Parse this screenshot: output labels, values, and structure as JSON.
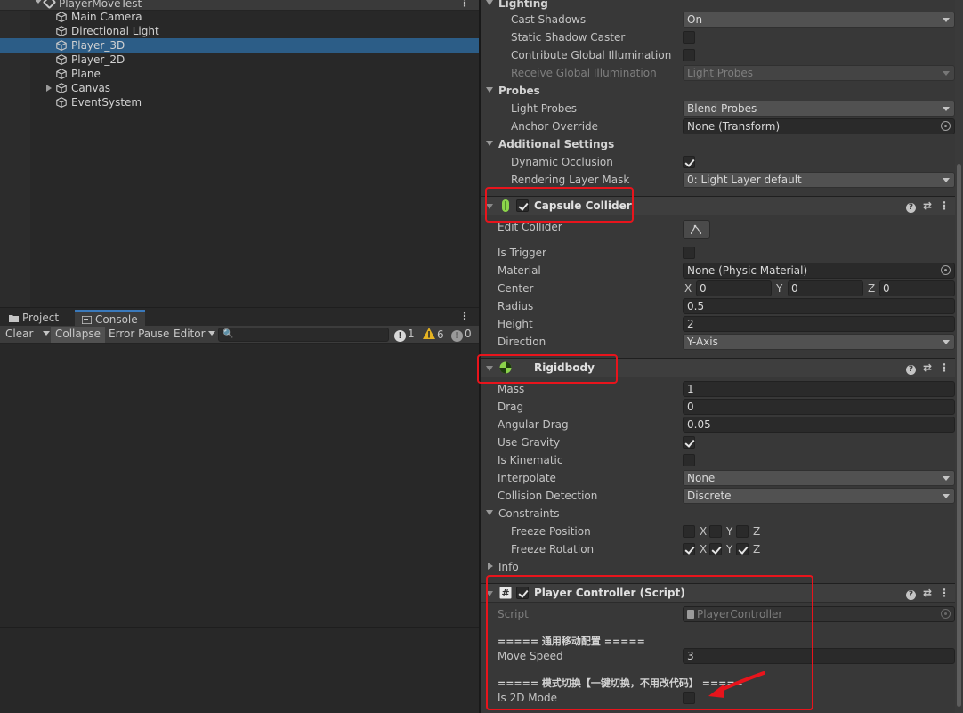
{
  "hierarchy": {
    "scene_name": "PlayerMoveTest",
    "items": [
      {
        "label": "Main Camera",
        "selected": false,
        "expandable": false
      },
      {
        "label": "Directional Light",
        "selected": false,
        "expandable": false
      },
      {
        "label": "Player_3D",
        "selected": true,
        "expandable": false
      },
      {
        "label": "Player_2D",
        "selected": false,
        "expandable": false
      },
      {
        "label": "Plane",
        "selected": false,
        "expandable": false
      },
      {
        "label": "Canvas",
        "selected": false,
        "expandable": true
      },
      {
        "label": "EventSystem",
        "selected": false,
        "expandable": false
      }
    ]
  },
  "console": {
    "tabs": [
      {
        "label": "Project",
        "active": false,
        "icon": "folder-icon"
      },
      {
        "label": "Console",
        "active": true,
        "icon": "console-icon"
      }
    ],
    "toolbar": {
      "clear_label": "Clear",
      "collapse_label": "Collapse",
      "error_pause_label": "Error Pause",
      "editor_label": "Editor",
      "search_placeholder": "",
      "log_count": "1",
      "warning_count": "6",
      "error_count": "0"
    }
  },
  "inspector": {
    "lighting": {
      "header": "Lighting",
      "cast_shadows_label": "Cast Shadows",
      "cast_shadows_value": "On",
      "static_shadow_caster_label": "Static Shadow Caster",
      "static_shadow_caster": false,
      "contribute_gi_label": "Contribute Global Illumination",
      "contribute_gi": false,
      "receive_gi_label": "Receive Global Illumination",
      "receive_gi_value": "Light Probes"
    },
    "probes": {
      "header": "Probes",
      "light_probes_label": "Light Probes",
      "light_probes_value": "Blend Probes",
      "anchor_override_label": "Anchor Override",
      "anchor_override_value": "None (Transform)"
    },
    "additional": {
      "header": "Additional Settings",
      "dynamic_occlusion_label": "Dynamic Occlusion",
      "dynamic_occlusion": true,
      "rendering_layer_mask_label": "Rendering Layer Mask",
      "rendering_layer_mask_value": "0: Light Layer default"
    },
    "capsule_collider": {
      "title": "Capsule Collider",
      "enabled": true,
      "edit_collider_label": "Edit Collider",
      "is_trigger_label": "Is Trigger",
      "is_trigger": false,
      "material_label": "Material",
      "material_value": "None (Physic Material)",
      "center_label": "Center",
      "center": {
        "x_label": "X",
        "x": "0",
        "y_label": "Y",
        "y": "0",
        "z_label": "Z",
        "z": "0"
      },
      "radius_label": "Radius",
      "radius": "0.5",
      "height_label": "Height",
      "height": "2",
      "direction_label": "Direction",
      "direction_value": "Y-Axis"
    },
    "rigidbody": {
      "title": "Rigidbody",
      "mass_label": "Mass",
      "mass": "1",
      "drag_label": "Drag",
      "drag": "0",
      "angular_drag_label": "Angular Drag",
      "angular_drag": "0.05",
      "use_gravity_label": "Use Gravity",
      "use_gravity": true,
      "is_kinematic_label": "Is Kinematic",
      "is_kinematic": false,
      "interpolate_label": "Interpolate",
      "interpolate_value": "None",
      "collision_detection_label": "Collision Detection",
      "collision_detection_value": "Discrete",
      "constraints_label": "Constraints",
      "freeze_position_label": "Freeze Position",
      "freeze_position": {
        "x": false,
        "y": false,
        "z": false
      },
      "freeze_rotation_label": "Freeze Rotation",
      "freeze_rotation": {
        "x": true,
        "y": true,
        "z": true
      },
      "axis_x": "X",
      "axis_y": "Y",
      "axis_z": "Z",
      "info_label": "Info"
    },
    "player_controller": {
      "title": "Player Controller (Script)",
      "enabled": true,
      "script_label": "Script",
      "script_value": "PlayerController",
      "section1": "===== 通用移动配置 =====",
      "move_speed_label": "Move Speed",
      "move_speed": "3",
      "section2": "===== 模式切换【一键切换，不用改代码】 =====",
      "is_2d_mode_label": "Is 2D Mode",
      "is_2d_mode": false
    }
  },
  "colors": {
    "annotation_red": "#e8141c",
    "selection_blue": "#2c5d87",
    "collider_green": "#8bd44a"
  }
}
